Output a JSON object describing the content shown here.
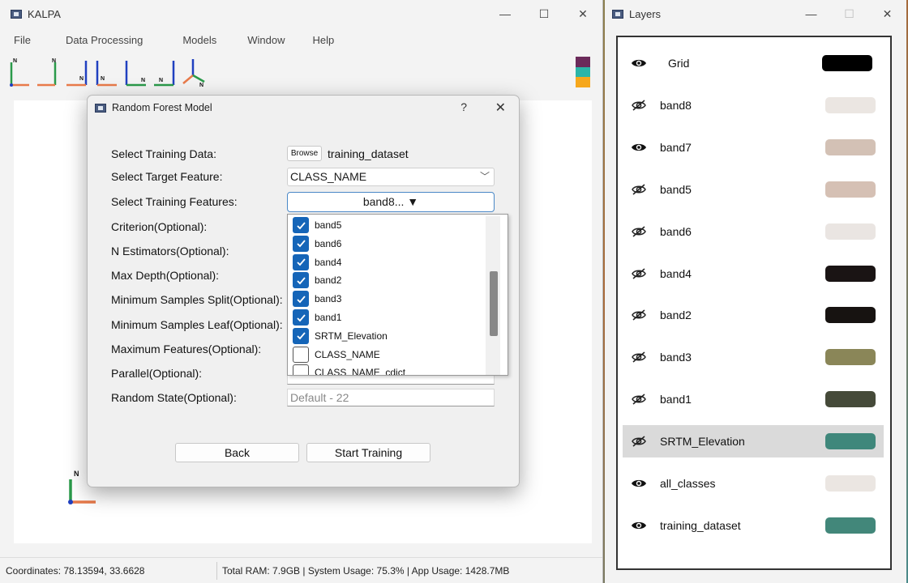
{
  "main_window": {
    "title": "KALPA",
    "controls": {
      "minimize": "—",
      "maximize": "☐",
      "close": "✕"
    },
    "menu": [
      "File",
      "Data Processing",
      "Models",
      "Window",
      "Help"
    ],
    "toolbar_icons": [
      "north-up-axis-icon",
      "north-axis-variant-icon",
      "north-axis-left-icon",
      "north-axis-down-icon",
      "north-axis-right-icon",
      "north-axis-rotated-icon",
      "north-axis-3d-icon"
    ],
    "color_strip": [
      "#6b2a5a",
      "#2bb5a8",
      "#f6a71c"
    ],
    "axis_label": "N"
  },
  "status": {
    "coords": "Coordinates: 78.13594, 33.6628",
    "system": "Total RAM: 7.9GB | System Usage: 75.3% | App Usage: 1428.7MB"
  },
  "dialog": {
    "title": "Random Forest Model",
    "help": "?",
    "close": "✕",
    "labels": {
      "training_data": "Select Training Data:",
      "target": "Select Target Feature:",
      "features": "Select Training Features:",
      "criterion": "Criterion(Optional):",
      "n_estimators": "N Estimators(Optional):",
      "max_depth": "Max Depth(Optional):",
      "min_split": "Minimum Samples Split(Optional):",
      "min_leaf": "Minimum Samples Leaf(Optional):",
      "max_features": "Maximum Features(Optional):",
      "parallel": "Parallel(Optional):",
      "random_state": "Random State(Optional):"
    },
    "browse_label": "Browse",
    "training_file": "training_dataset",
    "target_value": "CLASS_NAME",
    "features_button": "band8... ▼",
    "random_state_placeholder": "Default - 22",
    "feature_options": [
      {
        "label": "band5",
        "checked": true
      },
      {
        "label": "band6",
        "checked": true
      },
      {
        "label": "band4",
        "checked": true
      },
      {
        "label": "band2",
        "checked": true
      },
      {
        "label": "band3",
        "checked": true
      },
      {
        "label": "band1",
        "checked": true
      },
      {
        "label": "SRTM_Elevation",
        "checked": true
      },
      {
        "label": "CLASS_NAME",
        "checked": false
      },
      {
        "label": "CLASS_NAME_cdict",
        "checked": false
      }
    ],
    "back_label": "Back",
    "start_label": "Start Training"
  },
  "layers_window": {
    "title": "Layers",
    "controls": {
      "minimize": "—",
      "maximize": "☐",
      "close": "✕"
    },
    "layers": [
      {
        "name": "Grid",
        "visible": true,
        "color": "#000000",
        "selected": false
      },
      {
        "name": "band8",
        "visible": false,
        "color": "#ebe6e2",
        "selected": false
      },
      {
        "name": "band7",
        "visible": true,
        "color": "#d3c1b5",
        "selected": false
      },
      {
        "name": "band5",
        "visible": false,
        "color": "#d5c0b4",
        "selected": false
      },
      {
        "name": "band6",
        "visible": false,
        "color": "#eae5e2",
        "selected": false
      },
      {
        "name": "band4",
        "visible": false,
        "color": "#1a1414",
        "selected": false
      },
      {
        "name": "band2",
        "visible": false,
        "color": "#171311",
        "selected": false
      },
      {
        "name": "band3",
        "visible": false,
        "color": "#8a8658",
        "selected": false
      },
      {
        "name": "band1",
        "visible": false,
        "color": "#454a39",
        "selected": false
      },
      {
        "name": "SRTM_Elevation",
        "visible": false,
        "color": "#3f877b",
        "selected": true
      },
      {
        "name": "all_classes",
        "visible": true,
        "color": "#ebe6e2",
        "selected": false
      },
      {
        "name": "training_dataset",
        "visible": true,
        "color": "#42877a",
        "selected": false
      }
    ]
  }
}
